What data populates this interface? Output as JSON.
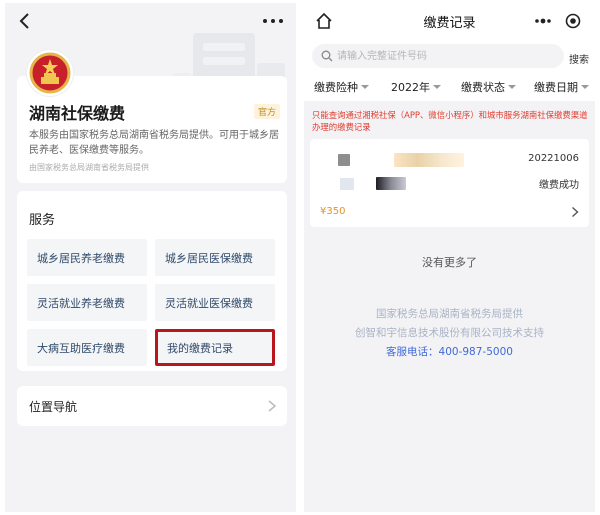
{
  "left": {
    "hero": {
      "title": "湖南社保缴费",
      "tag": "官方",
      "desc": "本服务由国家税务总局湖南省税务局提供。可用于城乡居民养老、医保缴费等服务。",
      "source": "由国家税务总局湖南省税务局提供"
    },
    "services": {
      "title": "服务",
      "items": [
        {
          "label": "城乡居民养老缴费"
        },
        {
          "label": "城乡居民医保缴费"
        },
        {
          "label": "灵活就业养老缴费"
        },
        {
          "label": "灵活就业医保缴费"
        },
        {
          "label": "大病互助医疗缴费"
        },
        {
          "label": "我的缴费记录"
        }
      ]
    },
    "nav": {
      "label": "位置导航"
    }
  },
  "right": {
    "title": "缴费记录",
    "search": {
      "placeholder": "请输入完整证件号码",
      "button": "搜索"
    },
    "filters": [
      {
        "label": "缴费险种"
      },
      {
        "label": "2022年"
      },
      {
        "label": "缴费状态"
      },
      {
        "label": "缴费日期"
      }
    ],
    "notice": "只能查询通过湘税社保（APP、微信小程序）和城市服务湖南社保缴费渠道办理的缴费记录",
    "record": {
      "date": "20221006",
      "status": "缴费成功",
      "amount": "¥350"
    },
    "no_more": "没有更多了",
    "footer": {
      "line1": "国家税务总局湖南省税务局提供",
      "line2": "创智和宇信息技术股份有限公司技术支持",
      "line3": "客服电话：400-987-5000"
    }
  },
  "colors": {
    "highlight": "#b8161b",
    "notice": "#e23b2e",
    "amount": "#e8922a",
    "link": "#3f6ad8"
  }
}
